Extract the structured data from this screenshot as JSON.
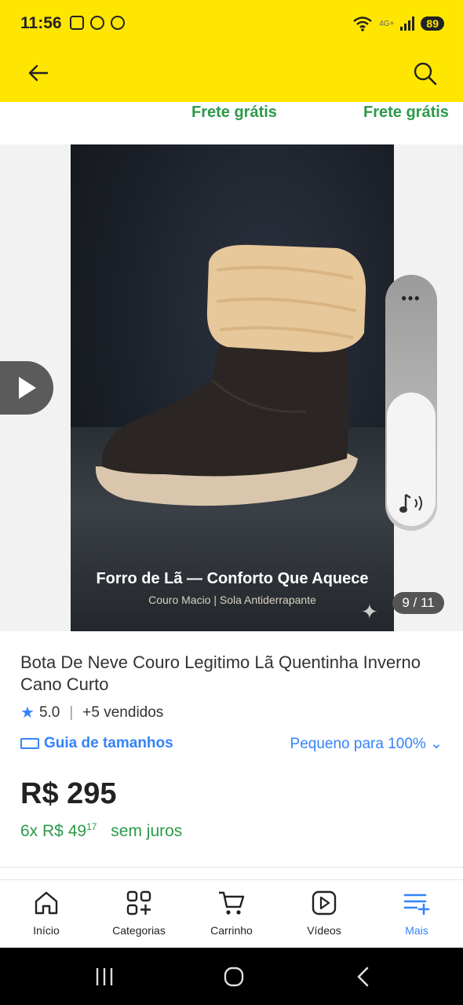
{
  "status_bar": {
    "time": "11:56",
    "network": "4G+",
    "battery": "89"
  },
  "header": {
    "back_icon": "arrow-left-icon",
    "search_icon": "search-icon"
  },
  "freight": {
    "left": "Frete grátis",
    "right": "Frete grátis"
  },
  "gallery": {
    "caption_title": "Forro de Lã — Conforto Que Aquece",
    "caption_sub": "Couro Macio | Sola Antiderrapante",
    "counter": "9 / 11"
  },
  "product": {
    "title": "Bota De Neve Couro Legitimo Lã Quentinha Inverno Cano Curto",
    "rating": "5.0",
    "sold": "+5 vendidos",
    "size_guide": "Guia de tamanhos",
    "fit": "Pequeno para 100%",
    "price": "R$ 295",
    "installments_prefix": "6x R$ 49",
    "installments_cents": "17",
    "installments_note": "sem juros"
  },
  "nav": [
    {
      "label": "Início",
      "icon": "home-icon"
    },
    {
      "label": "Categorias",
      "icon": "categories-icon"
    },
    {
      "label": "Carrinho",
      "icon": "cart-icon"
    },
    {
      "label": "Vídeos",
      "icon": "video-icon"
    },
    {
      "label": "Mais",
      "icon": "menu-plus-icon"
    }
  ],
  "colors": {
    "header": "#FFE600",
    "accent": "#3483fa",
    "green": "#2c9a4a"
  }
}
